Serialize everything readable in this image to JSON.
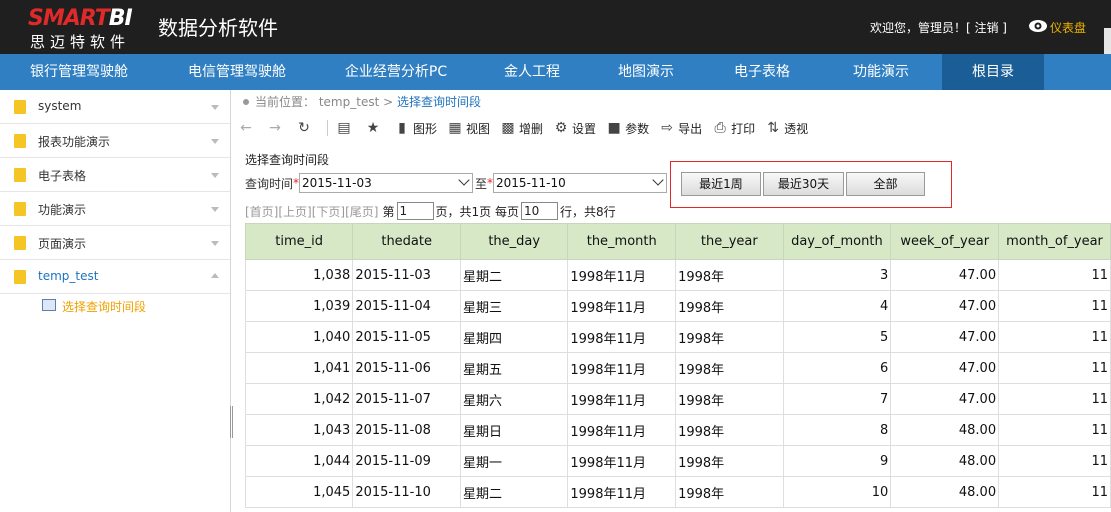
{
  "header": {
    "logo_main": "SMARTBI",
    "logo_sub": "思迈特软件",
    "app_title": "数据分析软件",
    "welcome": "欢迎您，管理员！[ 注销 ]",
    "dashboard": "仪表盘"
  },
  "nav": [
    {
      "label": "银行管理驾驶舱",
      "active": false
    },
    {
      "label": "电信管理驾驶舱",
      "active": false
    },
    {
      "label": "企业经营分析PC",
      "active": false
    },
    {
      "label": "金人工程",
      "active": false
    },
    {
      "label": "地图演示",
      "active": false
    },
    {
      "label": "电子表格",
      "active": false
    },
    {
      "label": "功能演示",
      "active": false
    },
    {
      "label": "根目录",
      "active": true
    }
  ],
  "sidebar": {
    "items": [
      {
        "label": "system"
      },
      {
        "label": "报表功能演示"
      },
      {
        "label": "电子表格"
      },
      {
        "label": "功能演示"
      },
      {
        "label": "页面演示"
      },
      {
        "label": "temp_test"
      }
    ],
    "sub_item": "选择查询时间段"
  },
  "breadcrumb": {
    "prefix": "当前位置：",
    "parent": "temp_test",
    "separator": ">",
    "current": "选择查询时间段"
  },
  "toolbar": {
    "chart": "图形",
    "view": "视图",
    "insert_delete": "增删",
    "settings": "设置",
    "params": "参数",
    "export": "导出",
    "print": "打印",
    "pivot": "透视"
  },
  "query": {
    "title": "选择查询时间段",
    "label": "查询时间",
    "required_mark": "*",
    "start_date": "2015-11-03",
    "to_label": "至",
    "end_date": "2015-11-10",
    "btn_week": "最近1周",
    "btn_30days": "最近30天",
    "btn_all": "全部"
  },
  "pager": {
    "first": "[首页]",
    "prev": "[上页]",
    "next": "[下页]",
    "last": "[尾页]",
    "page_prefix": "第",
    "page_value": "1",
    "page_suffix": "页，共1页 每页",
    "size_value": "10",
    "size_suffix": "行，共8行"
  },
  "table": {
    "columns": [
      "time_id",
      "thedate",
      "the_day",
      "the_month",
      "the_year",
      "day_of_month",
      "week_of_year",
      "month_of_year"
    ],
    "rows": [
      [
        "1,038",
        "2015-11-03",
        "星期二",
        "1998年11月",
        "1998年",
        "3",
        "47.00",
        "11"
      ],
      [
        "1,039",
        "2015-11-04",
        "星期三",
        "1998年11月",
        "1998年",
        "4",
        "47.00",
        "11"
      ],
      [
        "1,040",
        "2015-11-05",
        "星期四",
        "1998年11月",
        "1998年",
        "5",
        "47.00",
        "11"
      ],
      [
        "1,041",
        "2015-11-06",
        "星期五",
        "1998年11月",
        "1998年",
        "6",
        "47.00",
        "11"
      ],
      [
        "1,042",
        "2015-11-07",
        "星期六",
        "1998年11月",
        "1998年",
        "7",
        "47.00",
        "11"
      ],
      [
        "1,043",
        "2015-11-08",
        "星期日",
        "1998年11月",
        "1998年",
        "8",
        "48.00",
        "11"
      ],
      [
        "1,044",
        "2015-11-09",
        "星期一",
        "1998年11月",
        "1998年",
        "9",
        "48.00",
        "11"
      ],
      [
        "1,045",
        "2015-11-10",
        "星期二",
        "1998年11月",
        "1998年",
        "10",
        "48.00",
        "11"
      ]
    ]
  }
}
